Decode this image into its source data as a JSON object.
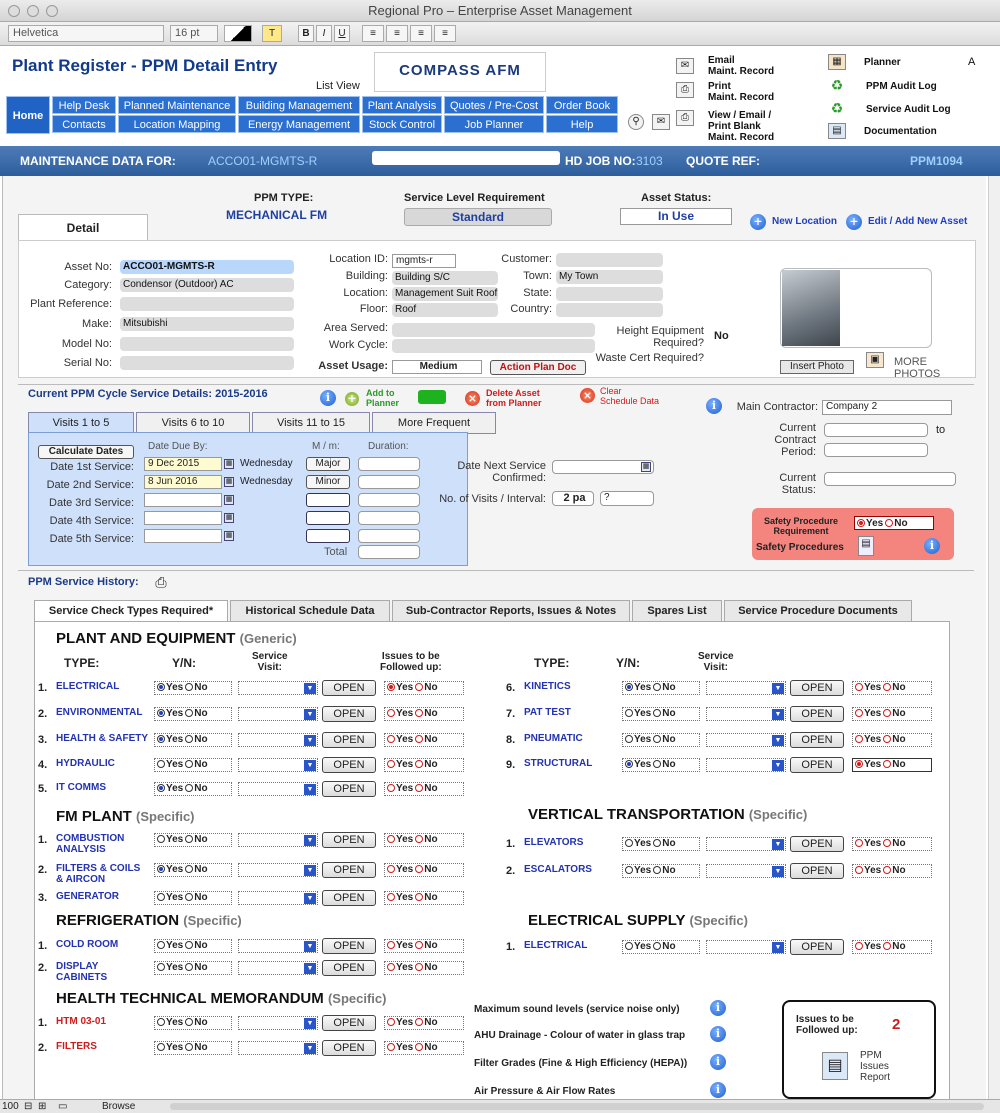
{
  "window": {
    "title": "Regional Pro – Enterprise Asset Management"
  },
  "format_bar": {
    "font": "Helvetica",
    "size": "16 pt",
    "t": "T",
    "bold": "B",
    "italic": "I",
    "underline": "U"
  },
  "header": {
    "title": "Plant Register - PPM Detail Entry",
    "list_view": "List View",
    "logo": "COMPASS AFM",
    "home": "Home",
    "nav_top": [
      "Help Desk",
      "Planned Maintenance",
      "Building Management",
      "Plant Analysis",
      "Quotes / Pre-Cost",
      "Order Book"
    ],
    "nav_bottom": [
      "Contacts",
      "Location Mapping",
      "Energy Management",
      "Stock Control",
      "Job Planner",
      "Help"
    ],
    "links": {
      "email": "Email\nMaint. Record",
      "print": "Print\nMaint. Record",
      "view": "View / Email /\nPrint Blank\nMaint. Record",
      "planner": "Planner",
      "ppm_audit": "PPM Audit Log",
      "service_audit": "Service Audit Log",
      "documentation": "Documentation",
      "a": "A"
    }
  },
  "maint_bar": {
    "label": "MAINTENANCE DATA FOR:",
    "value": "ACCO01-MGMTS-R",
    "hd_label": "HD JOB NO:",
    "hd_value": "3103",
    "quote_label": "QUOTE REF:",
    "ref": "PPM1094"
  },
  "top": {
    "ppm_type_label": "PPM TYPE:",
    "ppm_type": "MECHANICAL FM",
    "slr_label": "Service Level Requirement",
    "slr": "Standard",
    "status_label": "Asset Status:",
    "status": "In Use",
    "new_location": "New Location",
    "edit_asset": "Edit / Add New Asset",
    "detail_tab": "Detail"
  },
  "asset": {
    "labels": [
      "Asset No:",
      "Category:",
      "Plant Reference:",
      "Make:",
      "Model No:",
      "Serial No:"
    ],
    "values": [
      "ACCO01-MGMTS-R",
      "Condensor (Outdoor) AC",
      "",
      "Mitsubishi",
      "",
      ""
    ],
    "loc_labels": [
      "Location ID:",
      "Building:",
      "Location:",
      "Floor:"
    ],
    "loc_values": [
      "mgmts-r",
      "Building S/C",
      "Management Suit Roof",
      "Roof"
    ],
    "cust_labels": [
      "Customer:",
      "Town:",
      "State:",
      "Country:"
    ],
    "cust_values": [
      "",
      "My Town",
      "",
      ""
    ],
    "area_served": "Area Served:",
    "work_cycle": "Work Cycle:",
    "height_label": "Height Equipment\nRequired?",
    "height_value": "No",
    "waste_label": "Waste Cert Required?",
    "usage_label": "Asset Usage:",
    "usage": "Medium",
    "action_plan": "Action Plan Doc",
    "insert_photo": "Insert Photo",
    "more_photos": "MORE\nPHOTOS"
  },
  "cycle": {
    "title": "Current PPM Cycle Service Details:  2015-2016",
    "add_planner": "Add to\nPlanner",
    "delete_asset": "Delete Asset\nfrom Planner",
    "clear_schedule": "Clear\nSchedule Data",
    "tabs": [
      "Visits 1 to 5",
      "Visits 6 to 10",
      "Visits 11 to 15",
      "More Frequent"
    ],
    "calc": "Calculate Dates",
    "date_due": "Date Due By:",
    "mm": "M / m:",
    "duration": "Duration:",
    "rows": [
      {
        "label": "Date 1st Service:",
        "date": "9 Dec 2015",
        "day": "Wednesday",
        "type": "Major"
      },
      {
        "label": "Date 2nd Service:",
        "date": "8 Jun 2016",
        "day": "Wednesday",
        "type": "Minor"
      },
      {
        "label": "Date 3rd Service:",
        "date": "",
        "day": "",
        "type": ""
      },
      {
        "label": "Date 4th Service:",
        "date": "",
        "day": "",
        "type": ""
      },
      {
        "label": "Date 5th Service:",
        "date": "",
        "day": "",
        "type": ""
      }
    ],
    "total": "Total",
    "next_label": "Date Next Service\nConfirmed:",
    "visits_label": "No. of Visits / Interval:",
    "visits": "2 pa",
    "interval": "?",
    "main_contractor_label": "Main Contractor:",
    "main_contractor": "Company 2",
    "contract_label": "Current\nContract\nPeriod:",
    "to": "to",
    "status_label": "Current\nStatus:",
    "safety_req": "Safety Procedure\nRequirement",
    "safety_yes": "Yes",
    "safety_no": "No",
    "safety_proc": "Safety Procedures"
  },
  "history": {
    "title": "PPM Service History:",
    "tabs": [
      "Service Check Types Required*",
      "Historical Schedule Data",
      "Sub-Contractor Reports, Issues & Notes",
      "Spares List",
      "Service Procedure Documents"
    ],
    "col_type": "TYPE:",
    "col_yn": "Y/N:",
    "col_visit": "Service\nVisit:",
    "col_issues": "Issues to be\nFollowed up:",
    "open": "OPEN",
    "yes": "Yes",
    "no": "No",
    "sections": {
      "plant": "PLANT AND EQUIPMENT",
      "generic": "(Generic)",
      "fm": "FM PLANT",
      "vert": "VERTICAL TRANSPORTATION",
      "refrig": "REFRIGERATION",
      "elec": "ELECTRICAL SUPPLY",
      "htm": "HEALTH TECHNICAL MEMORANDUM",
      "specific": "(Specific)"
    },
    "items": {
      "plant_left": [
        {
          "n": "1.",
          "name": "ELECTRICAL"
        },
        {
          "n": "2.",
          "name": "ENVIRONMENTAL"
        },
        {
          "n": "3.",
          "name": "HEALTH & SAFETY"
        },
        {
          "n": "4.",
          "name": "HYDRAULIC"
        },
        {
          "n": "5.",
          "name": "IT COMMS"
        }
      ],
      "plant_right": [
        {
          "n": "6.",
          "name": "KINETICS"
        },
        {
          "n": "7.",
          "name": "PAT TEST"
        },
        {
          "n": "8.",
          "name": "PNEUMATIC"
        },
        {
          "n": "9.",
          "name": "STRUCTURAL"
        }
      ],
      "fm": [
        {
          "n": "1.",
          "name": "COMBUSTION\nANALYSIS"
        },
        {
          "n": "2.",
          "name": "FILTERS & COILS\n& AIRCON"
        },
        {
          "n": "3.",
          "name": "GENERATOR"
        }
      ],
      "vert": [
        {
          "n": "1.",
          "name": "ELEVATORS"
        },
        {
          "n": "2.",
          "name": "ESCALATORS"
        }
      ],
      "refrig": [
        {
          "n": "1.",
          "name": "COLD ROOM"
        },
        {
          "n": "2.",
          "name": "DISPLAY\nCABINETS"
        }
      ],
      "elec": [
        {
          "n": "1.",
          "name": "ELECTRICAL"
        }
      ],
      "htm": [
        {
          "n": "1.",
          "name": "HTM 03-01"
        },
        {
          "n": "2.",
          "name": "FILTERS"
        }
      ]
    },
    "info_rows": [
      "Maximum sound levels (service noise only)",
      "AHU Drainage - Colour of water in glass trap",
      "Filter Grades (Fine & High Efficiency (HEPA))",
      "Air Pressure & Air Flow Rates"
    ],
    "issues_box": {
      "label": "Issues to be\nFollowed up:",
      "count": "2",
      "report": "PPM\nIssues\nReport"
    }
  },
  "status_bar": {
    "zoom": "100",
    "mode": "Browse"
  },
  "colors": {
    "nav": "#2b6fd0",
    "bar": "#2d5d9c",
    "link": "#2332b0",
    "alert": "#d01b1b"
  }
}
